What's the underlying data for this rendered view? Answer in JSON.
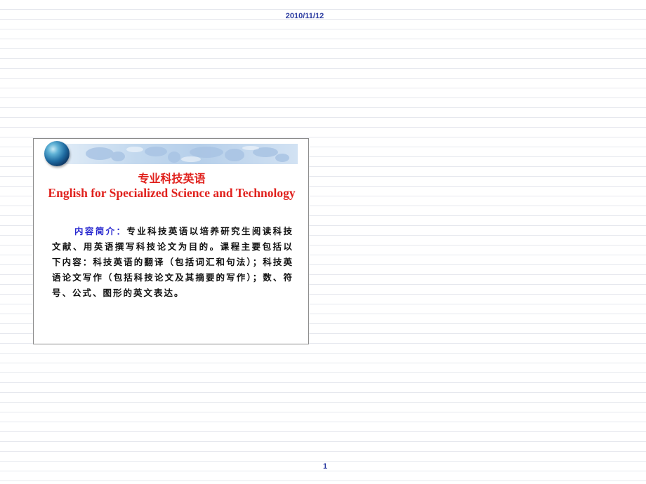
{
  "header": {
    "date": "2010/11/12"
  },
  "slide": {
    "title_cn": "专业科技英语",
    "title_en": "English for Specialized Science and Technology",
    "intro_label": "内容简介：",
    "intro_text": "专业科技英语以培养研究生阅读科技文献、用英语撰写科技论文为目的。课程主要包括以下内容：科技英语的翻译（包括词汇和句法）；科技英语论文写作（包括科技论文及其摘要的写作）；数、符号、公式、图形的英文表达。"
  },
  "footer": {
    "page_number": "1"
  },
  "colors": {
    "title": "#e0201c",
    "label": "#2a2ad0",
    "header_text": "#2a3aa0"
  },
  "icons": {
    "globe": "globe-icon",
    "banner": "world-map-banner"
  }
}
